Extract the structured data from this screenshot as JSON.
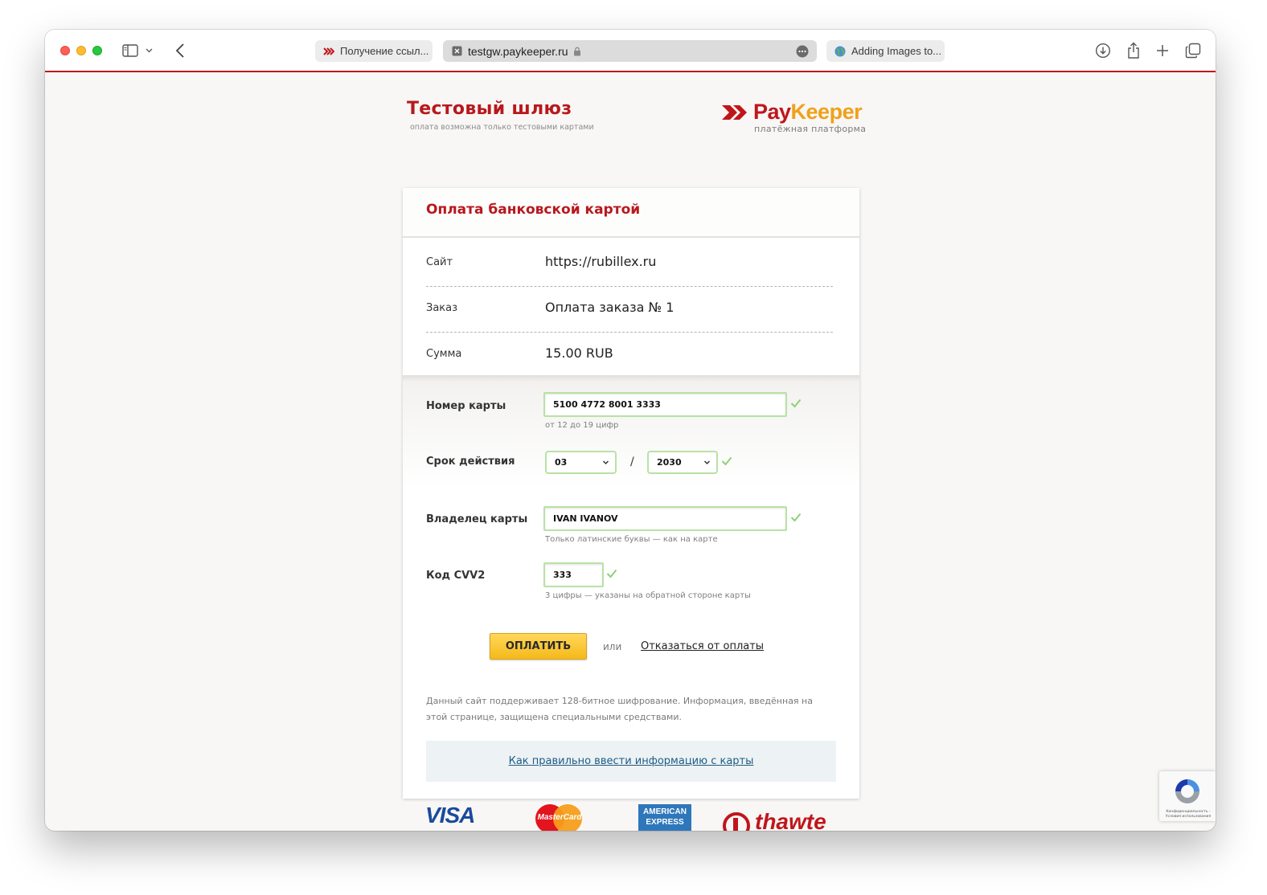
{
  "browser": {
    "tabs": [
      {
        "label": "Получение ссыл..."
      },
      {
        "label": "testgw.paykeeper.ru"
      },
      {
        "label": "Adding Images to..."
      }
    ]
  },
  "brand": {
    "title": "Тестовый шлюз",
    "subtitle": "оплата возможна только тестовыми картами",
    "logo_pay": "Pay",
    "logo_keeper": "Keeper",
    "logo_sub": "платёжная платформа"
  },
  "card": {
    "title": "Оплата банковской картой",
    "info": [
      {
        "label": "Сайт",
        "value": "https://rubillex.ru"
      },
      {
        "label": "Заказ",
        "value": "Оплата заказа № 1"
      },
      {
        "label": "Сумма",
        "value": "15.00 RUB"
      }
    ]
  },
  "form": {
    "card_number_label": "Номер карты",
    "card_number_value": "5100 4772 8001 3333",
    "card_number_hint": "от 12 до 19 цифр",
    "expiry_label": "Срок действия",
    "expiry_month": "03",
    "expiry_separator": "/",
    "expiry_year": "2030",
    "holder_label": "Владелец карты",
    "holder_value": "IVAN IVANOV",
    "holder_hint": "Только латинские буквы — как на карте",
    "cvv_label": "Код CVV2",
    "cvv_value": "333",
    "cvv_hint": "3 цифры — указаны на обратной стороне карты",
    "pay_button": "ОПЛАТИТЬ",
    "or_text": "или",
    "cancel_link": "Отказаться от оплаты",
    "security_note": "Данный сайт поддерживает 128-битное шифрование. Информация, введённая на этой странице, защищена специальными средствами.",
    "help_link": "Как правильно ввести информацию с карты"
  },
  "footer_logos": {
    "visa": "VISA",
    "mastercard": "MasterCard",
    "amex_1": "AMERICAN",
    "amex_2": "EXPRESS",
    "thawte": "thawte"
  },
  "recaptcha": {
    "text": "Конфиденциальность - Условия использования"
  },
  "colors": {
    "brand_red": "#b8181d",
    "keeper_orange": "#f0a11b",
    "valid_green": "#b8e2a5",
    "pay_yellow": "#f5b91a"
  }
}
